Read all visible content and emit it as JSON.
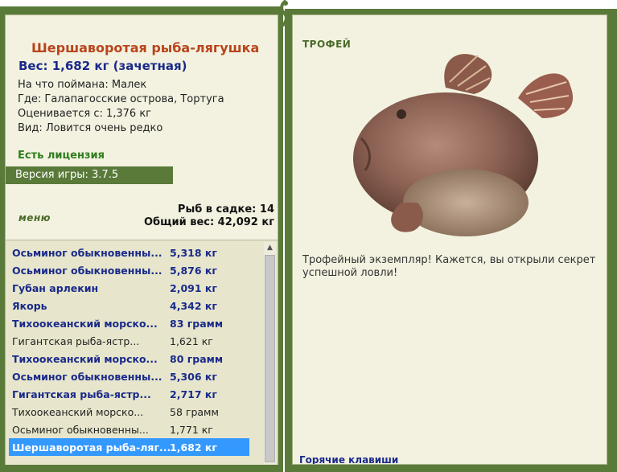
{
  "fish_info": {
    "name": "Шершаворотая рыба-лягушка",
    "weight_line": "Вес: 1,682 кг (зачетная)",
    "caught_on": "На что поймана: Малек",
    "location": "Где: Галапагосские острова, Тортуга",
    "valued_from": "Оценивается с: 1,376 кг",
    "rarity": "Вид: Ловится очень редко"
  },
  "license": "Есть лицензия",
  "version": "Версия игры: 3.7.5",
  "menu_label": "меню",
  "keep_net": {
    "fish_count": "Рыб в садке: 14",
    "total_weight": "Общий вес: 42,092 кг"
  },
  "catch_list": [
    {
      "name": "Осьминог обыкновенны...",
      "weight": "5,318 кг",
      "style": "bold"
    },
    {
      "name": "Осьминог обыкновенны...",
      "weight": "5,876 кг",
      "style": "bold"
    },
    {
      "name": "Губан арлекин",
      "weight": "2,091 кг",
      "style": "bold"
    },
    {
      "name": "Якорь",
      "weight": "4,342 кг",
      "style": "bold"
    },
    {
      "name": "Тихоокеанский морско...",
      "weight": "83 грамм",
      "style": "bold"
    },
    {
      "name": "Гигантская рыба-ястр...",
      "weight": "1,621 кг",
      "style": "normal"
    },
    {
      "name": "Тихоокеанский морско...",
      "weight": "80 грамм",
      "style": "bold"
    },
    {
      "name": "Осьминог обыкновенны...",
      "weight": "5,306 кг",
      "style": "bold"
    },
    {
      "name": "Гигантская рыба-ястр...",
      "weight": "2,717 кг",
      "style": "bold"
    },
    {
      "name": "Тихоокеанский морско...",
      "weight": "58 грамм",
      "style": "normal"
    },
    {
      "name": "Осьминог обыкновенны...",
      "weight": "1,771 кг",
      "style": "normal"
    },
    {
      "name": "Шершаворотая рыба-ляг...",
      "weight": "1,682 кг",
      "style": "selected"
    }
  ],
  "trophy": {
    "title": "ТРОФЕЙ",
    "text": "Трофейный экземпляр! Кажется, вы открыли секрет успешной ловли!"
  },
  "hotkeys_link": "Горячие клавиши",
  "colors": {
    "frame_green": "#5a7a3a",
    "panel_bg": "#f3f2e0",
    "name_orange": "#b9441c",
    "navy_text": "#1a2a8a",
    "selected_blue": "#3399ff"
  }
}
